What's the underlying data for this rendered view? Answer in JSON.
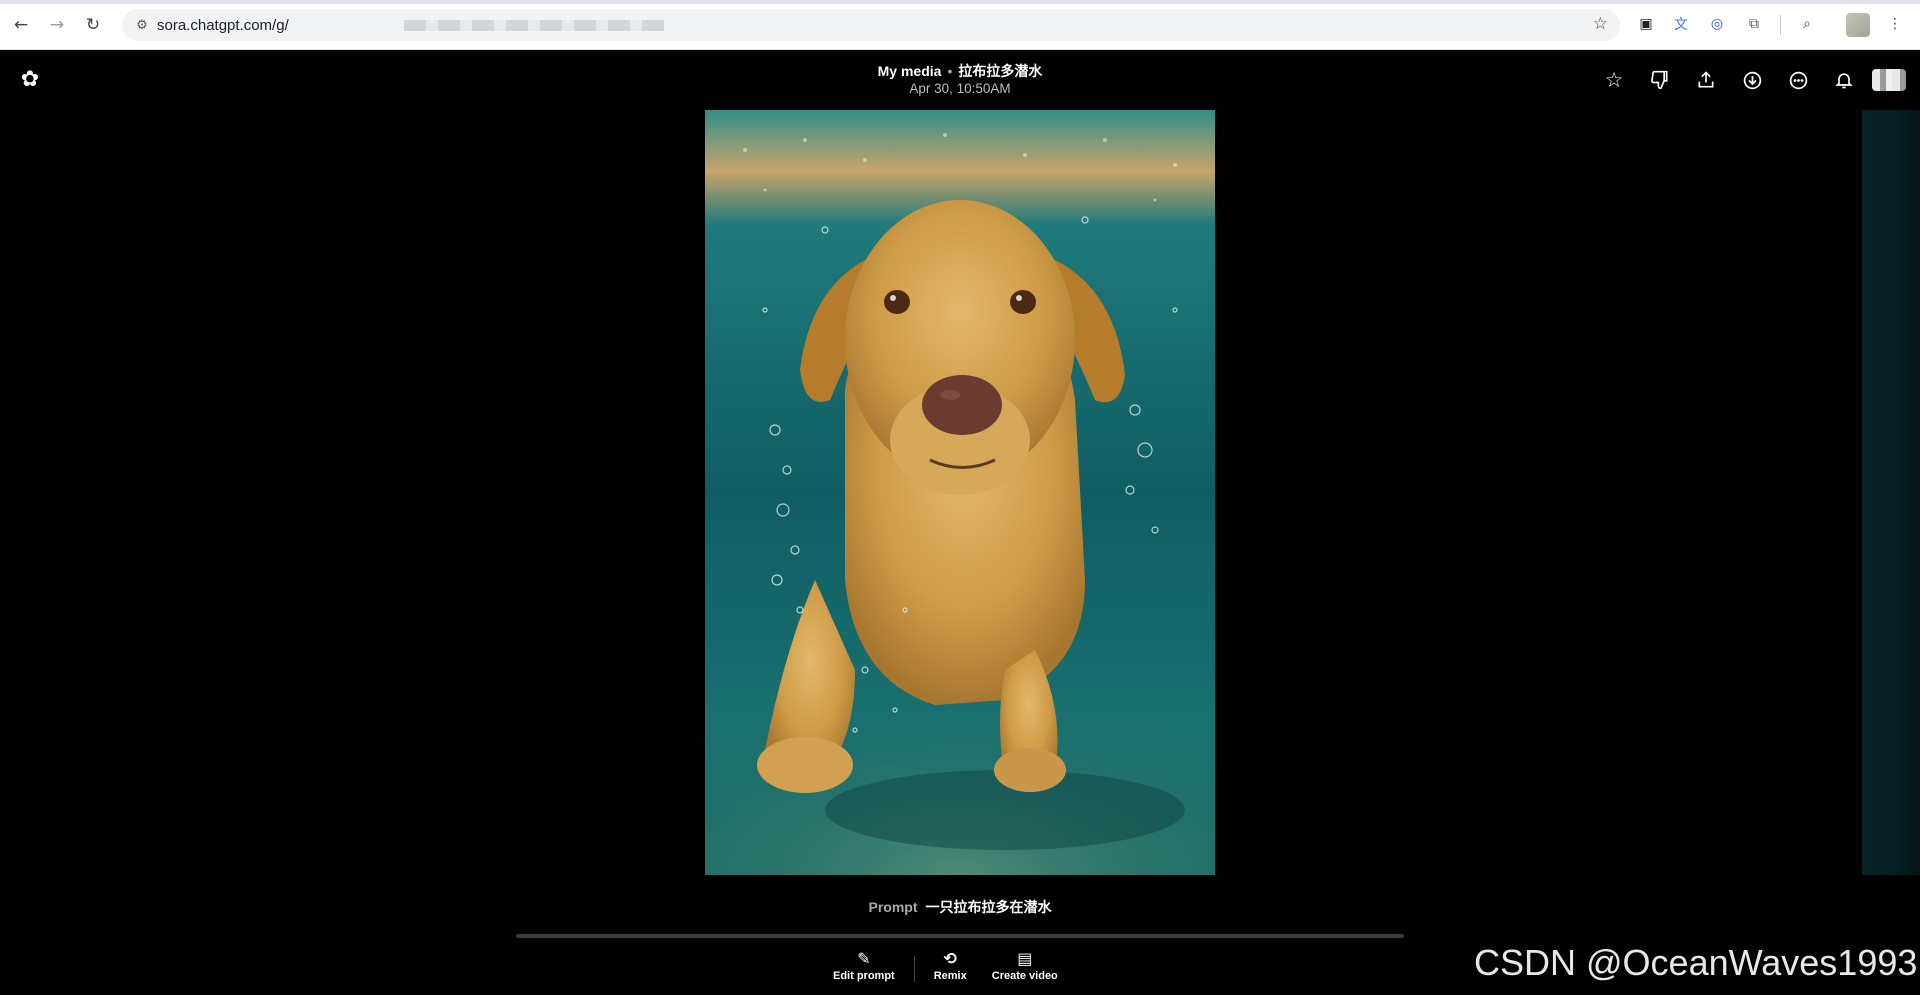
{
  "browser": {
    "url": "sora.chatgpt.com/g/",
    "icons": [
      "back-icon",
      "forward-icon",
      "reload-icon",
      "site-settings-icon",
      "bookmark-star-icon",
      "extension-icon",
      "translate-icon",
      "account-icon",
      "puzzle-icon",
      "tab-search-icon",
      "more-icon"
    ]
  },
  "header": {
    "section": "My media",
    "separator": "•",
    "title": "拉布拉多潜水",
    "date": "Apr 30, 10:50AM",
    "actions": [
      "star-icon",
      "dislike-icon",
      "share-icon",
      "download-icon",
      "more-icon",
      "bell-icon"
    ]
  },
  "prompt": {
    "label": "Prompt",
    "text": "一只拉布拉多在潜水"
  },
  "actions": {
    "edit_prompt": "Edit prompt",
    "remix": "Remix",
    "create_video": "Create video"
  },
  "watermark": "CSDN @OceanWaves1993"
}
